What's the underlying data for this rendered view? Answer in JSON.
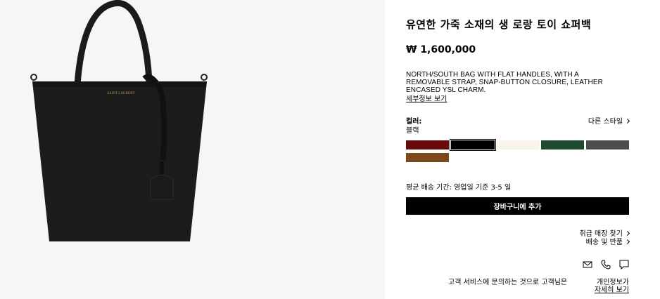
{
  "product": {
    "title": "유연한 가죽 소재의 생 로랑 토이 쇼퍼백",
    "price": "₩ 1,600,000",
    "description": "NORTH/SOUTH BAG WITH FLAT HANDLES, WITH A REMOVABLE STRAP, SNAP-BUTTON CLOSURE, LEATHER ENCASED YSL CHARM.",
    "detail_link": "세부정보 보기",
    "image_alt": "SAINT LAURENT"
  },
  "color": {
    "label": "컬러:",
    "value": "블랙",
    "other_styles": "다른 스타일",
    "swatches": [
      {
        "name": "dark-red",
        "hex": "#6b0a0a",
        "selected": false
      },
      {
        "name": "black",
        "hex": "#000000",
        "selected": true
      },
      {
        "name": "cream",
        "hex": "#f8f4ea",
        "selected": false
      },
      {
        "name": "dark-green",
        "hex": "#1e4a30",
        "selected": false
      },
      {
        "name": "grey",
        "hex": "#4d4d4d",
        "selected": false
      },
      {
        "name": "brown",
        "hex": "#7a4a1c",
        "selected": false
      }
    ]
  },
  "shipping": {
    "delivery_text": "평균 배송 기간: 영업일 기준 3-5 일",
    "cart_button": "장바구니에 추가",
    "store_link": "취급 매장 찾기",
    "return_link": "배송 및 반품"
  },
  "contact": {
    "icons": [
      "mail-icon",
      "phone-icon",
      "chat-icon"
    ],
    "service_text": "고객 서비스에 문의하는 것으로 고객님은",
    "privacy_link": "개인정보가",
    "privacy_more": "자세히 보기"
  }
}
